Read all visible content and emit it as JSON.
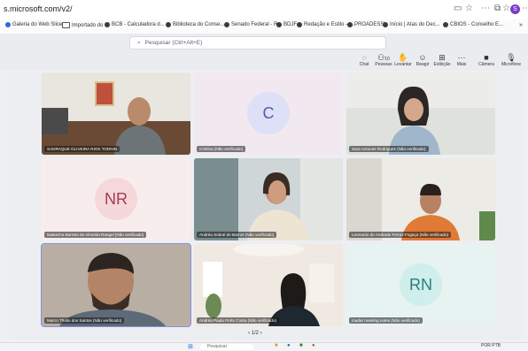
{
  "browser": {
    "url": "s.microsoft.com/v2/",
    "profile_initial": "S",
    "bookmarks": [
      "Galeria do Web Slice",
      "Importado do IE",
      "BCB - Calculadora d...",
      "Biblioteca do Conse...",
      "Senado Federal - R...",
      "BDJF",
      "Redação e Estilo —...",
      "PROADESSI",
      "Início | Atas do Dec...",
      "CBIOS - Conselho E..."
    ]
  },
  "teams": {
    "search_placeholder": "Pesquisar (Ctrl+Alt+E)",
    "toolbar": {
      "chat": "Chat",
      "people": "Pessoas",
      "people_count": "10",
      "raise": "Levantar",
      "react": "Reagir",
      "view": "Exibição",
      "more": "Mais",
      "camera": "Câmera",
      "mic": "Microfone"
    },
    "participants": [
      {
        "name": "SADRAQUE OLIVEIRA RIOS TODNIN",
        "type": "video"
      },
      {
        "name": "Cristina (Não verificado)",
        "type": "avatar",
        "initials": "C"
      },
      {
        "name": "Sara Antunes Rodrigues (Não verificado)",
        "type": "video"
      },
      {
        "name": "Natascha Barreto de Almeida Rangel (Não verificado)",
        "type": "avatar",
        "initials": "NR"
      },
      {
        "name": "Andréa Sobral de Barros (Não verificado)",
        "type": "video"
      },
      {
        "name": "Leonardo de Andrade Ferraz Fogaça (Não verificado)",
        "type": "video"
      },
      {
        "name": "Marco Thulio dos Santos (Não verificado)",
        "type": "video"
      },
      {
        "name": "Andréa Paula Porto Costa (Não verificado)",
        "type": "video"
      },
      {
        "name": "madar meeting notes (Não verificado)",
        "type": "avatar",
        "initials": "RN"
      }
    ],
    "pager": "1/2"
  },
  "taskbar": {
    "search": "Pesquisar",
    "lang": "POR",
    "sub": "PTB"
  },
  "colors": {
    "active_tile_border": "#8a8fd8"
  }
}
